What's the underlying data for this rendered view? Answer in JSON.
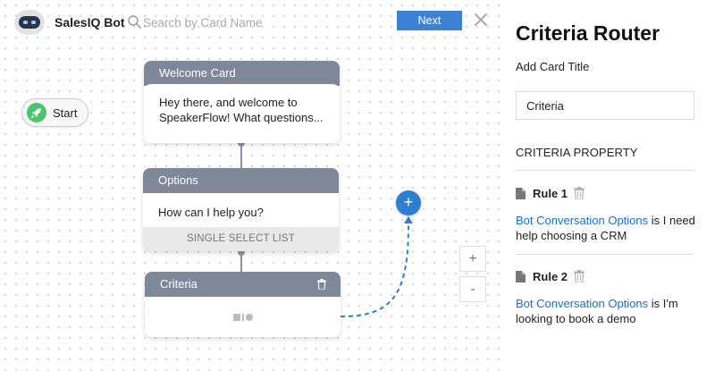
{
  "header": {
    "bot_name": "SalesIQ Bot",
    "search_placeholder": "Search by Card Name",
    "next_label": "Next"
  },
  "canvas": {
    "start_label": "Start",
    "cards": {
      "welcome": {
        "title": "Welcome Card",
        "body": "Hey there, and welcome to SpeakerFlow! What questions..."
      },
      "options": {
        "title": "Options",
        "body": "How can I help you?",
        "footer": "SINGLE SELECT LIST"
      },
      "criteria": {
        "title": "Criteria"
      }
    },
    "add_label": "+",
    "zoom_in_label": "+",
    "zoom_out_label": "-"
  },
  "panel": {
    "title": "Criteria Router",
    "card_title_label": "Add Card Title",
    "card_title_value": "Criteria",
    "section_heading": "CRITERIA PROPERTY",
    "rules": [
      {
        "name": "Rule 1",
        "field": "Bot Conversation Options",
        "text": " is I need help choosing a CRM"
      },
      {
        "name": "Rule 2",
        "field": "Bot Conversation Options",
        "text": " is I'm looking to book a demo"
      }
    ]
  },
  "colors": {
    "accent": "#3b82d6",
    "card_header": "#7f8899",
    "start_green": "#4cc46e",
    "link": "#1a6fc8",
    "add_node": "#2d7fd1"
  },
  "icons": [
    "bot-avatar-icon",
    "search-icon",
    "close-icon",
    "rocket-icon",
    "trash-icon",
    "document-icon",
    "condition-icon"
  ]
}
